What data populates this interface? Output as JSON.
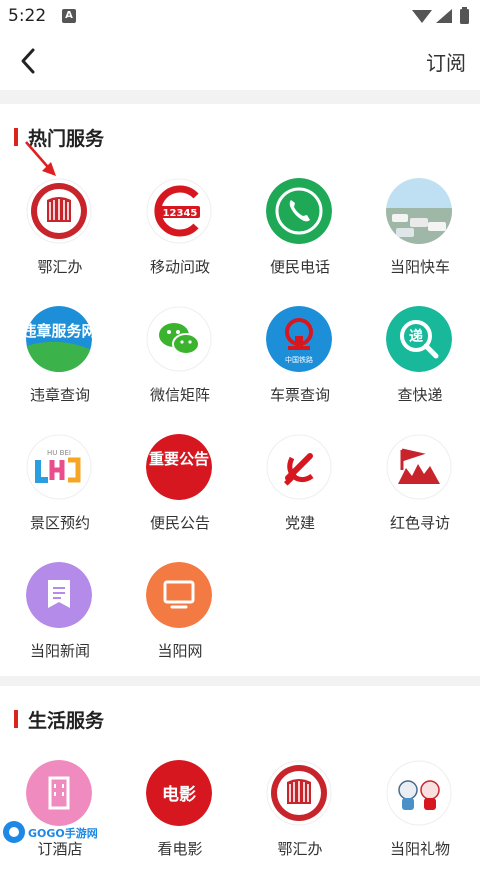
{
  "status_bar": {
    "time": "5:22",
    "notification_badge": "A"
  },
  "header": {
    "subscribe_label": "订阅"
  },
  "sections": [
    {
      "title": "热门服务",
      "items": [
        {
          "label": "鄂汇办",
          "icon": "ehuiban-logo-icon"
        },
        {
          "label": "移动问政",
          "icon": "mobile-politics-icon"
        },
        {
          "label": "便民电话",
          "icon": "phone-icon"
        },
        {
          "label": "当阳快车",
          "icon": "express-car-icon"
        },
        {
          "label": "违章查询",
          "icon": "violation-query-icon",
          "badge_text": "违章服务网"
        },
        {
          "label": "微信矩阵",
          "icon": "wechat-icon"
        },
        {
          "label": "车票查询",
          "icon": "railway-icon",
          "badge_text": "中国铁路"
        },
        {
          "label": "查快递",
          "icon": "express-query-icon",
          "badge_text": "递"
        },
        {
          "label": "景区预约",
          "icon": "scenic-booking-icon",
          "badge_text": "HU BEI"
        },
        {
          "label": "便民公告",
          "icon": "notice-icon",
          "badge_text": "重要公告"
        },
        {
          "label": "党建",
          "icon": "party-icon"
        },
        {
          "label": "红色寻访",
          "icon": "red-visit-icon"
        },
        {
          "label": "当阳新闻",
          "icon": "news-icon"
        },
        {
          "label": "当阳网",
          "icon": "web-icon"
        }
      ]
    },
    {
      "title": "生活服务",
      "items": [
        {
          "label": "订酒店",
          "icon": "hotel-icon"
        },
        {
          "label": "看电影",
          "icon": "movie-icon",
          "badge_text": "电影"
        },
        {
          "label": "鄂汇办",
          "icon": "ehuiban-logo-icon"
        },
        {
          "label": "当阳礼物",
          "icon": "gift-icon"
        }
      ]
    }
  ],
  "watermark": {
    "text": "GOGO手游网"
  },
  "colors": {
    "accent": "#d9251c"
  }
}
